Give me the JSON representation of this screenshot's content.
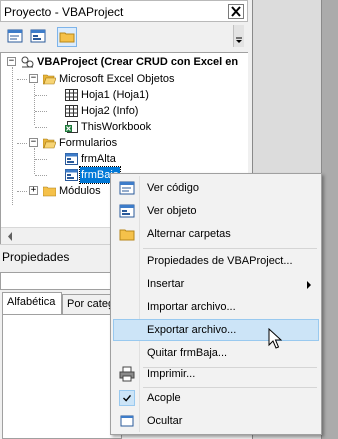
{
  "project_pane": {
    "title": "Proyecto - VBAProject",
    "close_glyph": "✕",
    "toolbar": [
      {
        "icon": "view-code-icon"
      },
      {
        "icon": "view-object-icon"
      },
      {
        "icon": "toggle-folders-icon",
        "pressed": true
      }
    ]
  },
  "tree": {
    "root": "VBAProject (Crear CRUD con Excel en",
    "excel_objects": "Microsoft Excel Objetos",
    "hoja1": "Hoja1 (Hoja1)",
    "hoja2": "Hoja2 (Info)",
    "thisworkbook": "ThisWorkbook",
    "formularios": "Formularios",
    "frmalta": "frmAlta",
    "frmbaja": "frmBaja",
    "modulos": "Módulos",
    "expand_minus": "−",
    "expand_plus": "+"
  },
  "properties_pane": {
    "title": "Propiedades",
    "tabs": [
      "Alfabética",
      "Por categ"
    ]
  },
  "context_menu": {
    "items": [
      {
        "label": "Ver código",
        "icon": "view-code-icon"
      },
      {
        "label": "Ver objeto",
        "icon": "view-object-icon"
      },
      {
        "label": "Alternar carpetas",
        "icon": "folder-icon"
      },
      {
        "label": "Propiedades de VBAProject...",
        "icon": ""
      },
      {
        "label": "Insertar",
        "icon": "",
        "submenu": true
      },
      {
        "label": "Importar archivo...",
        "icon": ""
      },
      {
        "label": "Exportar archivo...",
        "icon": "",
        "highlighted": true
      },
      {
        "label": "Quitar frmBaja...",
        "icon": ""
      },
      {
        "label": "Imprimir...",
        "icon": "printer-icon"
      },
      {
        "label": "Acople",
        "icon": "checkmark-icon",
        "checked": true
      },
      {
        "label": "Ocultar",
        "icon": "hide-window-icon"
      }
    ]
  },
  "colors": {
    "selection": "#0078d7",
    "menu_highlight": "#cce4f7",
    "menu_highlight_border": "#99c9ef"
  }
}
